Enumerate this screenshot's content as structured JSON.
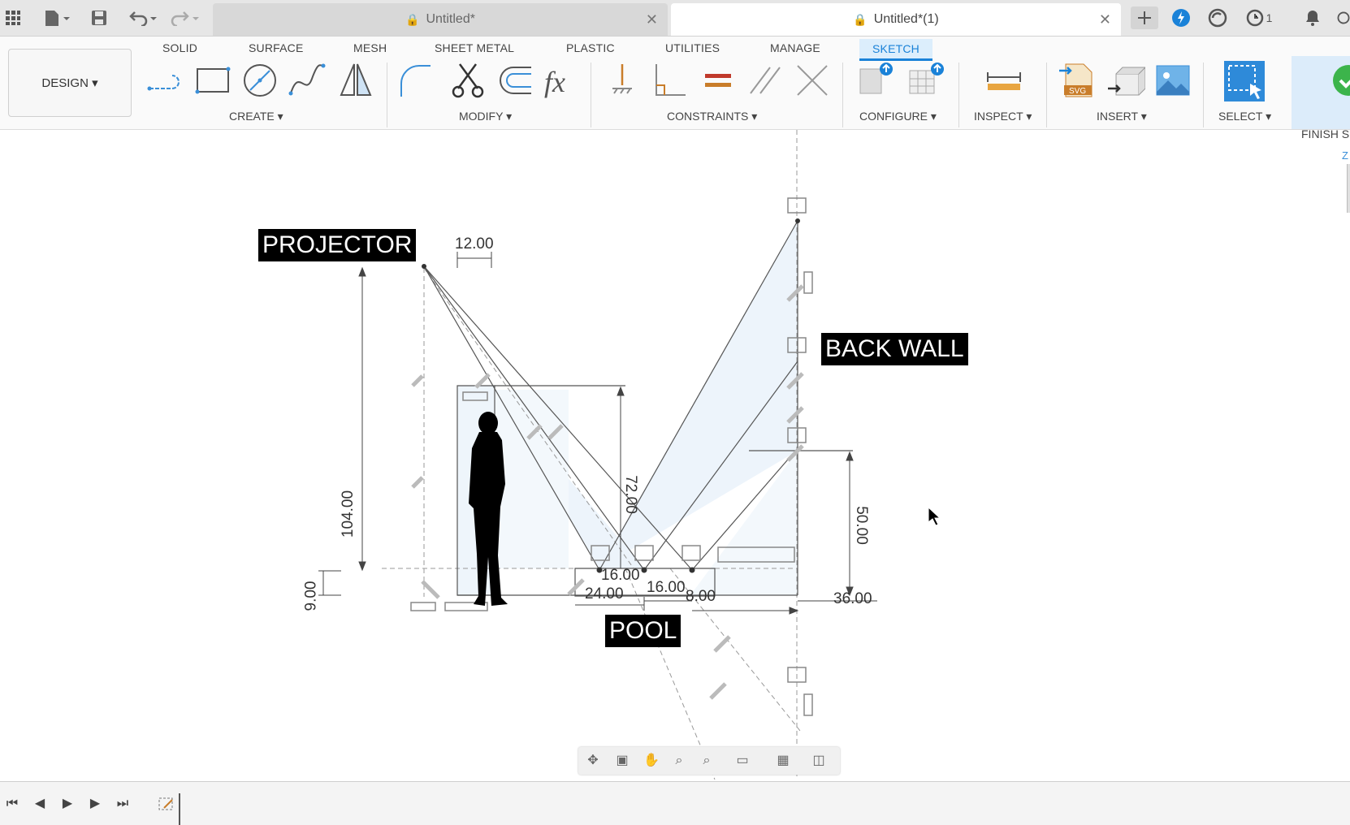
{
  "tabs": [
    {
      "title": "Untitled*",
      "active": false
    },
    {
      "title": "Untitled*(1)",
      "active": true
    }
  ],
  "tabbar_icons": {
    "apps": "grid-icon",
    "file": "file-icon",
    "save": "save-icon",
    "undo": "undo-icon",
    "redo": "redo-icon",
    "new_tab": "plus-icon",
    "extensions": "extension-icon",
    "online": "online-icon",
    "jobs": "clock-icon",
    "jobs_count": "1",
    "notifications": "bell-icon"
  },
  "workspace_tabs": [
    "SOLID",
    "SURFACE",
    "MESH",
    "SHEET METAL",
    "PLASTIC",
    "UTILITIES",
    "MANAGE",
    "SKETCH"
  ],
  "active_workspace_tab": "SKETCH",
  "design_button": "DESIGN ▾",
  "groups": {
    "create": "CREATE ▾",
    "modify": "MODIFY ▾",
    "constraints": "CONSTRAINTS ▾",
    "configure": "CONFIGURE ▾",
    "inspect": "INSPECT ▾",
    "insert": "INSERT ▾",
    "select": "SELECT ▾",
    "finish": "FINISH S"
  },
  "accent_color": "#1a82d8",
  "callouts": {
    "projector": "PROJECTOR",
    "back_wall": "BACK WALL",
    "pool": "POOL"
  },
  "dimensions": {
    "d12": "12.00",
    "d104": "104.00",
    "d72": "72.00",
    "d9": "9.00",
    "d50": "50.00",
    "d16a": "16.00",
    "d24": "24.00",
    "d16b": "16.00",
    "d8": "8.00",
    "d36": "36.00"
  },
  "viewcube_axis": "Z",
  "navbar_icons": [
    "orbit-icon",
    "look-at-icon",
    "pan-icon",
    "zoom-icon",
    "zoom-window-icon",
    "display-settings-icon",
    "grid-settings-icon",
    "viewports-icon"
  ],
  "timeline_icons": [
    "first-frame-icon",
    "previous-frame-icon",
    "play-icon",
    "next-frame-icon",
    "last-frame-icon",
    "sketch-feature-icon"
  ]
}
